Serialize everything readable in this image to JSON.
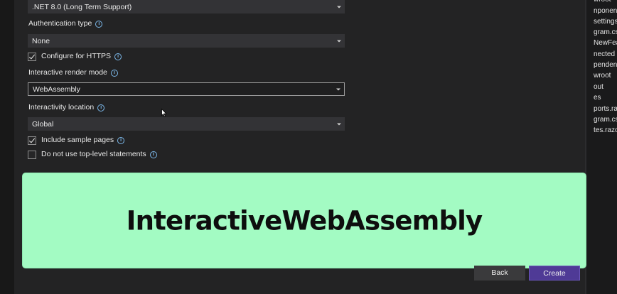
{
  "framework": {
    "value": ".NET 8.0 (Long Term Support)"
  },
  "auth": {
    "label": "Authentication type",
    "value": "None"
  },
  "https": {
    "label": "Configure for HTTPS",
    "checked": true
  },
  "render_mode": {
    "label": "Interactive render mode",
    "value": "WebAssembly"
  },
  "interactivity": {
    "label": "Interactivity location",
    "value": "Global"
  },
  "sample_pages": {
    "label": "Include sample pages",
    "checked": true
  },
  "top_level": {
    "label": "Do not use top-level statements",
    "checked": false
  },
  "banner": {
    "text": "InteractiveWebAssembly"
  },
  "buttons": {
    "back": "Back",
    "create": "Create"
  },
  "solution_items": [
    "wroot",
    "nponent",
    "settings",
    "gram.cs",
    "NewFeat",
    "nected",
    "pendenc",
    "wroot",
    "out",
    "es",
    "ports.raz",
    "gram.cs",
    "tes.razo"
  ]
}
